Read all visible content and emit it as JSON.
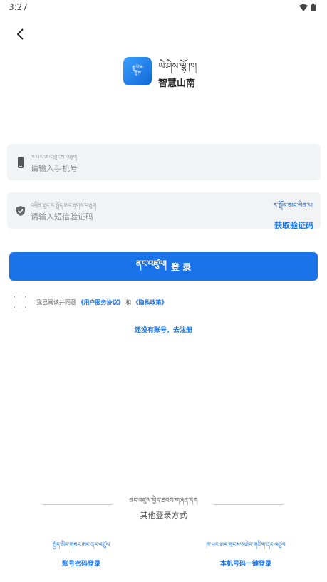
{
  "status_bar": {
    "time": "3:27",
    "icons": [
      "wifi-icon",
      "battery-icon"
    ]
  },
  "nav": {
    "back_icon": "chevron-left-icon"
  },
  "app": {
    "logo_icon": "app-logo-icon",
    "logo_line1": "རྒྱུ་ཡི་ཆ",
    "logo_line2": "ལྷོ་ཁ",
    "name_tibetan": "ཡེ་ཤེས་ལྷོ་ཁ།",
    "name": "智慧山南"
  },
  "phone_field": {
    "icon": "phone-icon",
    "label_tibetan": "ཁ་པར་ཨང་གྲངས་བཅུག",
    "placeholder": "请输入手机号",
    "value": ""
  },
  "code_field": {
    "icon": "shield-check-icon",
    "label_tibetan": "འཕྲིན་ཐུང་ར་སྤྲོད་ཨང་རྟགས་བཅུག",
    "placeholder": "请输入短信验证码",
    "value": "",
    "get_code_tibetan": "ར་སྤྲོད་ཨང་ལེན་པ།",
    "get_code_label": "获取验证码"
  },
  "login_button": {
    "tibetan": "ནང་འཛུལ།",
    "label": "登 录"
  },
  "agreement": {
    "prefix": "我已阅读并同意",
    "user_agreement": "《用户服务协议》",
    "conjunction": "和",
    "privacy_policy": "《隐私政策》",
    "checked": false
  },
  "register_link": "还没有账号，去注册",
  "other_login": {
    "tibetan": "ནང་འཛུལ་བྱེད་ཐབས་གཞན་དག",
    "label": "其他登录方式",
    "options": [
      {
        "tibetan": "སྤྱོད་མིང་གསང་ཨང་ནང་འཛུལ",
        "label": "账号密码登录"
      },
      {
        "tibetan": "ཁ་པར་ཨང་གྲངས་མཐེབ་གཅིག་ནང་འཛུལ",
        "label": "本机号码一键登录"
      }
    ]
  },
  "colors": {
    "accent": "#1a73e8",
    "field_bg": "#f2f3f5"
  }
}
